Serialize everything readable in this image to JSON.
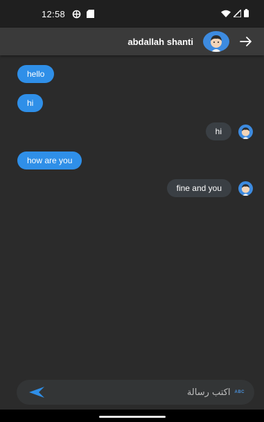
{
  "status_bar": {
    "time": "12:58",
    "icons": [
      "data-saver-icon",
      "sd-card-icon",
      "wifi-icon",
      "signal-icon",
      "battery-icon"
    ]
  },
  "header": {
    "contact_name": "abdallah shanti",
    "avatar_icon": "avatar-icon",
    "nav_icon": "arrow-right-icon"
  },
  "messages": [
    {
      "text": "hello",
      "direction": "incoming"
    },
    {
      "text": "hi",
      "direction": "incoming"
    },
    {
      "text": "hi",
      "direction": "outgoing"
    },
    {
      "text": "how are you",
      "direction": "incoming"
    },
    {
      "text": "fine and you",
      "direction": "outgoing"
    }
  ],
  "composer": {
    "placeholder": "اكتب رسالة",
    "keyboard_hint": "ABC",
    "send_icon": "send-icon"
  },
  "colors": {
    "background": "#2b2b2b",
    "app_bar": "#3a3a3a",
    "incoming_bubble": "#2f8fe8",
    "outgoing_bubble": "#3a3f44",
    "accent": "#3d8be0"
  }
}
